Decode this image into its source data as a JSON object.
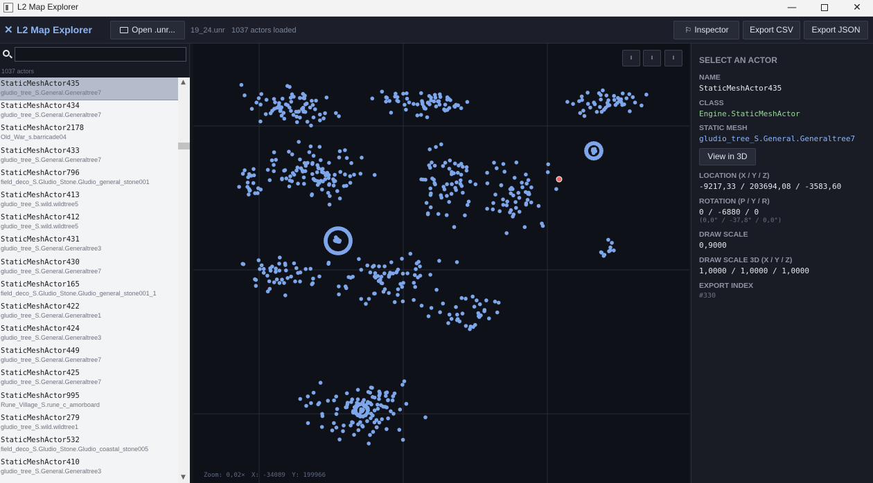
{
  "window": {
    "title": "L2 Map Explorer",
    "min_glyph": "—",
    "close_glyph": "✕"
  },
  "header": {
    "brand": "L2 Map Explorer",
    "brand_icon": "crossed-swords-icon",
    "open_button": "Open .unr...",
    "file_name": "19_24.unr",
    "actors_loaded": "1037 actors loaded",
    "inspector_button": "Inspector",
    "export_csv_button": "Export CSV",
    "export_json_button": "Export JSON"
  },
  "sidebar": {
    "search_placeholder": "",
    "count": "1037 actors",
    "items": [
      {
        "name": "StaticMeshActor435",
        "mesh": "gludio_tree_S.General.Generaltree7",
        "selected": true
      },
      {
        "name": "StaticMeshActor434",
        "mesh": "gludio_tree_S.General.Generaltree7"
      },
      {
        "name": "StaticMeshActor2178",
        "mesh": "Old_War_s.barricade04"
      },
      {
        "name": "StaticMeshActor433",
        "mesh": "gludio_tree_S.General.Generaltree7"
      },
      {
        "name": "StaticMeshActor796",
        "mesh": "field_deco_S.Gludio_Stone.Gludio_general_stone001"
      },
      {
        "name": "StaticMeshActor413",
        "mesh": "gludio_tree_S.wild.wildtree5"
      },
      {
        "name": "StaticMeshActor412",
        "mesh": "gludio_tree_S.wild.wildtree5"
      },
      {
        "name": "StaticMeshActor431",
        "mesh": "gludio_tree_S.General.Generaltree3"
      },
      {
        "name": "StaticMeshActor430",
        "mesh": "gludio_tree_S.General.Generaltree7"
      },
      {
        "name": "StaticMeshActor165",
        "mesh": "field_deco_S.Gludio_Stone.Gludio_general_stone001_1"
      },
      {
        "name": "StaticMeshActor422",
        "mesh": "gludio_tree_S.General.Generaltree1"
      },
      {
        "name": "StaticMeshActor424",
        "mesh": "gludio_tree_S.General.Generaltree3"
      },
      {
        "name": "StaticMeshActor449",
        "mesh": "gludio_tree_S.General.Generaltree7"
      },
      {
        "name": "StaticMeshActor425",
        "mesh": "gludio_tree_S.General.Generaltree7"
      },
      {
        "name": "StaticMeshActor995",
        "mesh": "Rune_Village_S.rune_c_amorboard"
      },
      {
        "name": "StaticMeshActor279",
        "mesh": "gludio_tree_S.wild.wildtree1"
      },
      {
        "name": "StaticMeshActor532",
        "mesh": "field_deco_S.Gludio_Stone.Gludio_coastal_stone005"
      },
      {
        "name": "StaticMeshActor410",
        "mesh": "gludio_tree_S.General.Generaltree3"
      }
    ]
  },
  "map": {
    "controls": [
      "ı",
      "ı",
      "ı"
    ],
    "zoom": "Zoom: 0,02×",
    "x": "X: -34089",
    "y": "Y: 199966",
    "colors": {
      "point": "#7ea6ea",
      "selected": "#e86a6a",
      "grid": "#262a36",
      "background": "#0f1119"
    }
  },
  "inspector": {
    "title": "SELECT AN ACTOR",
    "name_label": "NAME",
    "name": "StaticMeshActor435",
    "class_label": "CLASS",
    "class": "Engine.StaticMeshActor",
    "mesh_label": "STATIC MESH",
    "mesh": "gludio_tree_S.General.Generaltree7",
    "view3d_button": "View in 3D",
    "location_label": "LOCATION (X / Y / Z)",
    "location": "-9217,33  /  203694,08  /  -3583,60",
    "rotation_label": "ROTATION (P / Y / R)",
    "rotation": "0  /  -6880  /  0",
    "rotation_deg": "(0,0°  / -37,8°  /  0,0°)",
    "scale_label": "DRAW SCALE",
    "scale": "0,9000",
    "scale3d_label": "DRAW SCALE 3D (X / Y / Z)",
    "scale3d": "1,0000  /  1,0000  /  1,0000",
    "export_label": "EXPORT INDEX",
    "export_index": "#330"
  }
}
